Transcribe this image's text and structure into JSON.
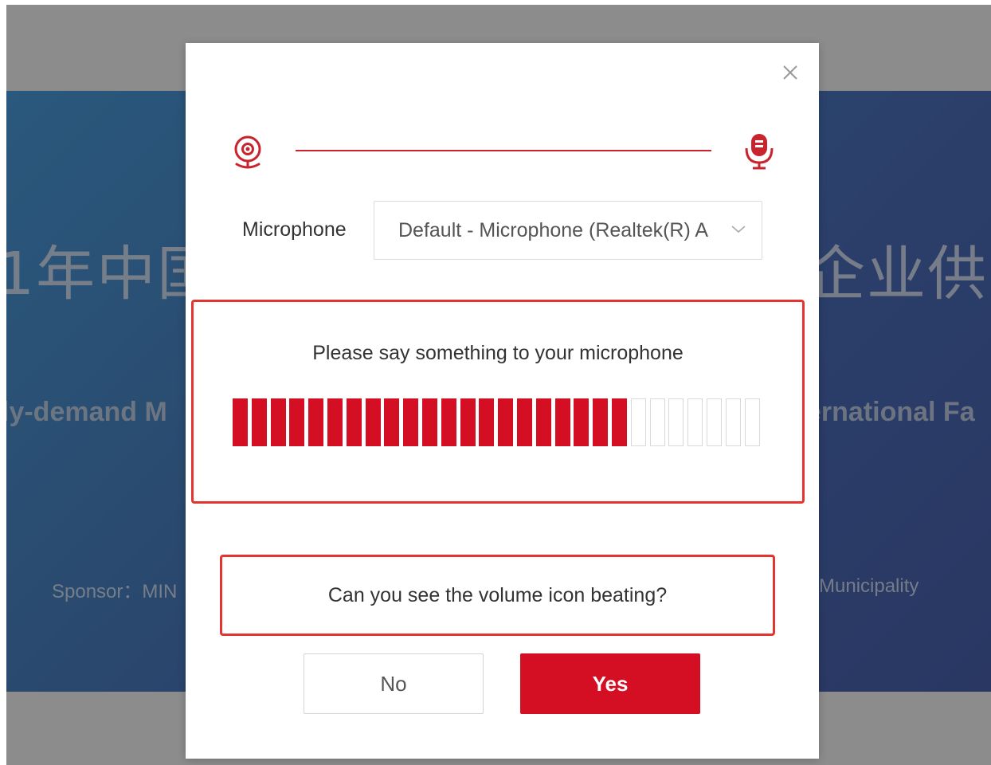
{
  "background": {
    "title_left": "1年中国",
    "title_right": "企业供需",
    "subtitle_left": "ly-demand M",
    "subtitle_right": "ernational Fa",
    "sponsor_left": "Sponsor：MIN",
    "sponsor_right": "Municipality"
  },
  "dialog": {
    "close_icon": "close-icon",
    "steps": [
      {
        "icon": "webcam-icon"
      },
      {
        "icon": "microphone-icon"
      }
    ],
    "microphone_label": "Microphone",
    "microphone_value": "Default - Microphone (Realtek(R) A",
    "test_prompt": "Please say something to your microphone",
    "volume": {
      "lit_bars": 21,
      "total_bars": 28
    },
    "question": "Can you see the volume icon beating?",
    "no_label": "No",
    "yes_label": "Yes"
  },
  "colors": {
    "accent": "#d40f24",
    "highlight_border": "#e4342f"
  }
}
